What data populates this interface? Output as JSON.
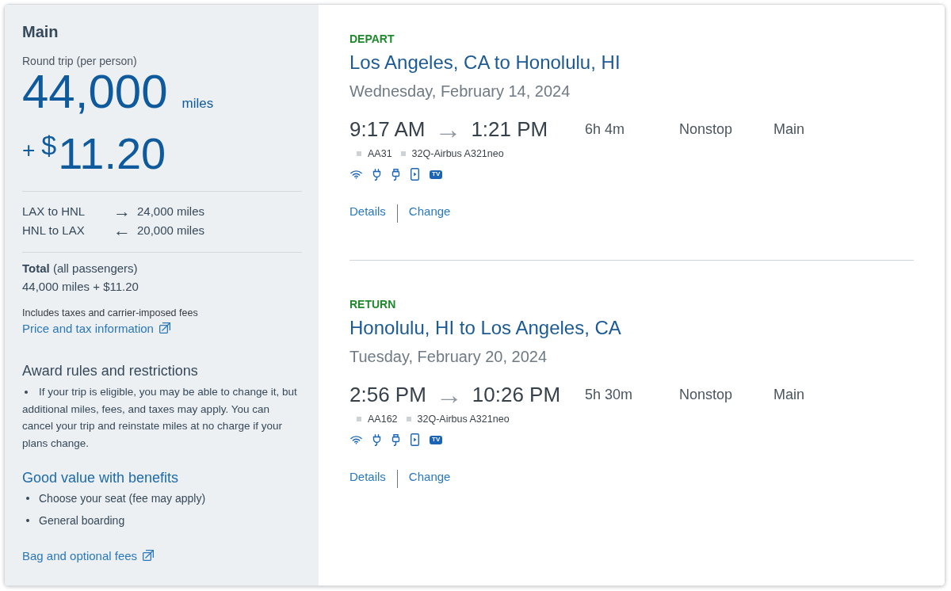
{
  "fare_panel": {
    "title": "Main",
    "price_label": "Round trip (per person)",
    "miles": "44,000",
    "miles_unit": "miles",
    "plus": "+",
    "currency": "$",
    "amount": "11.20",
    "legs": [
      {
        "route": "LAX to HNL",
        "arrow": "→",
        "miles": "24,000 miles"
      },
      {
        "route": "HNL to LAX",
        "arrow": "←",
        "miles": "20,000 miles"
      }
    ],
    "total": {
      "label": "**Total** (all passengers)",
      "value": "44,000 miles + $11.20"
    },
    "fees_note": "Includes taxes and carrier-imposed fees",
    "price_link": "Price and tax information",
    "rules": {
      "heading": "Award rules and restrictions",
      "items": [
        "If your trip is eligible, you may be able to change it, but additional miles, fees, and taxes may apply. You can cancel your trip and reinstate miles at no charge if your plans change."
      ]
    },
    "benefits": {
      "heading": "Good value with benefits",
      "items": [
        "Choose your seat (fee may apply)",
        "General boarding"
      ]
    },
    "bag_link": "Bag and optional fees"
  },
  "slices": [
    {
      "label": "DEPART",
      "route": "Los Angeles, CA to Honolulu, HI",
      "date": "Wednesday, February 14, 2024",
      "depart_time": "9:17 AM",
      "arrow": "→",
      "arrive_time": "1:21 PM",
      "duration": "6h 4m",
      "stops": "Nonstop",
      "cabin": "Main",
      "flight": "AA31",
      "aircraft": "32Q-Airbus A321neo",
      "amenities": [
        {
          "kind": "wifi"
        },
        {
          "kind": "power"
        },
        {
          "kind": "usb"
        },
        {
          "kind": "streaming"
        },
        {
          "kind": "tv",
          "label": "TV"
        }
      ],
      "links": [
        "Details",
        "Change"
      ]
    },
    {
      "label": "RETURN",
      "route": "Honolulu, HI to Los Angeles, CA",
      "date": "Tuesday, February 20, 2024",
      "depart_time": "2:56 PM",
      "arrow": "→",
      "arrive_time": "10:26 PM",
      "duration": "5h 30m",
      "stops": "Nonstop",
      "cabin": "Main",
      "flight": "AA162",
      "aircraft": "32Q-Airbus A321neo",
      "amenities": [
        {
          "kind": "wifi"
        },
        {
          "kind": "power"
        },
        {
          "kind": "usb"
        },
        {
          "kind": "streaming"
        },
        {
          "kind": "tv",
          "label": "TV"
        }
      ],
      "links": [
        "Details",
        "Change"
      ]
    }
  ]
}
